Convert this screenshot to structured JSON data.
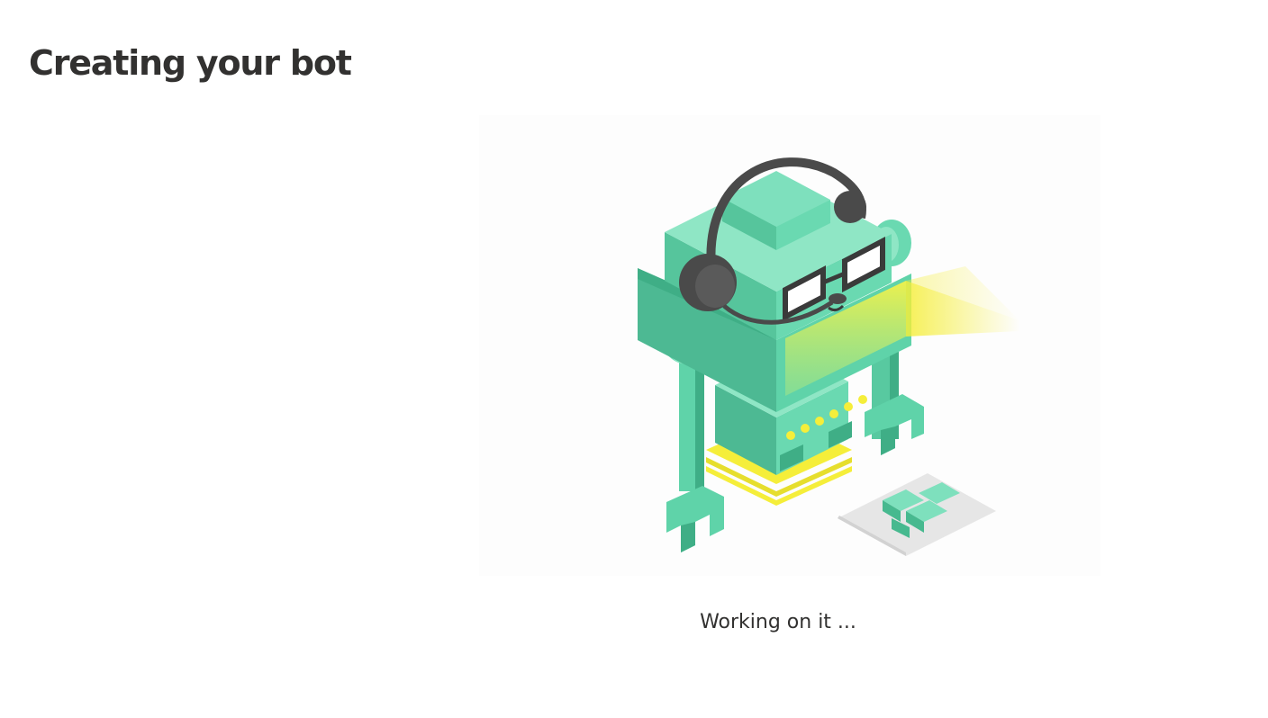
{
  "page": {
    "title": "Creating your bot",
    "status": "Working on it ..."
  },
  "illustration": {
    "subject": "robot-with-headset",
    "colors": {
      "body": "#5fd3a9",
      "body_dark": "#41b08a",
      "body_light": "#8fe6c5",
      "headset": "#4a4a4a",
      "accent_yellow": "#f5ee3a",
      "pad": "#e3e3e3"
    }
  }
}
